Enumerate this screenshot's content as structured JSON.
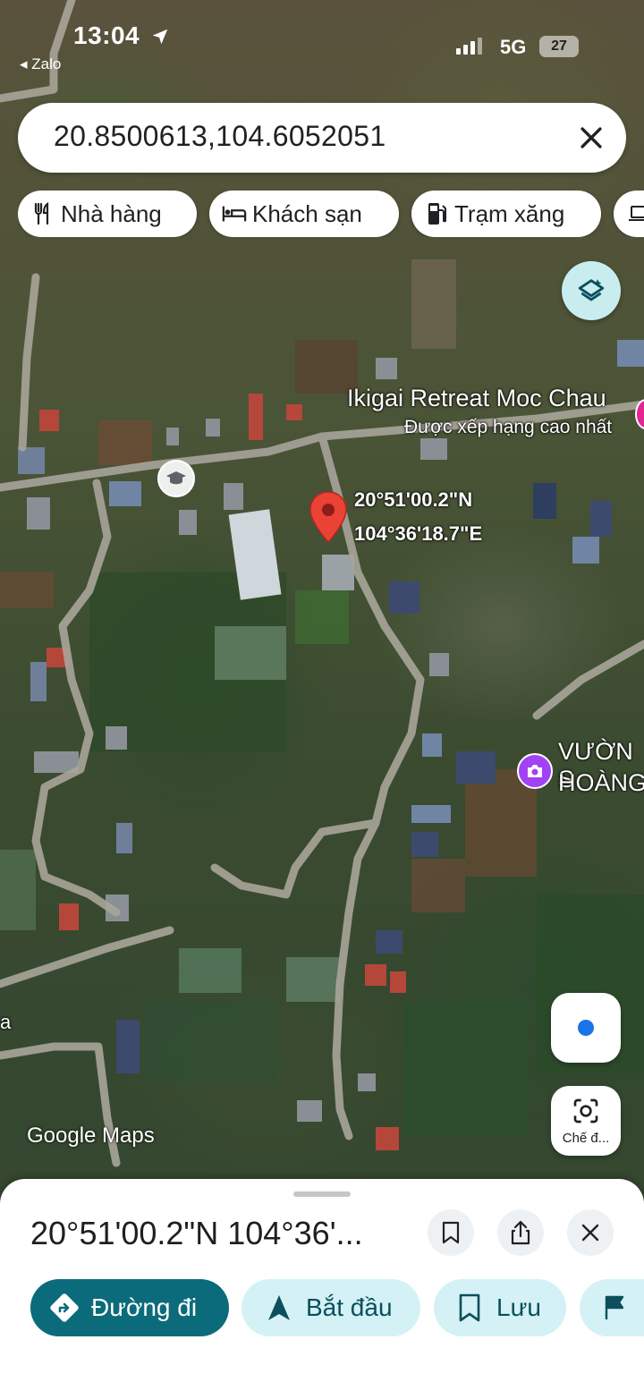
{
  "status_bar": {
    "time": "13:04",
    "back_app": "◂ Zalo",
    "network": "5G",
    "battery": "27"
  },
  "search": {
    "value": "20.8500613,104.6052051"
  },
  "chips": [
    {
      "label": "Nhà hàng",
      "icon": "fork-knife-icon"
    },
    {
      "label": "Khách sạn",
      "icon": "bed-icon"
    },
    {
      "label": "Trạm xăng",
      "icon": "gas-pump-icon"
    }
  ],
  "map": {
    "poi_title": "Ikigai Retreat Moc Chau",
    "poi_subtitle": "Được xếp hạng cao nhất",
    "pin_lat": "20°51'00.2\"N",
    "pin_lng": "104°36'18.7\"E",
    "garden_line1": "VƯỜN S",
    "garden_line2": "HOÀNG",
    "left_partial": "a",
    "watermark": "Google Maps",
    "lens_label": "Chế đ..."
  },
  "sheet": {
    "title": "20°51'00.2\"N 104°36'...",
    "actions": [
      {
        "label": "Đường đi",
        "icon": "directions-icon"
      },
      {
        "label": "Bắt đầu",
        "icon": "navigation-arrow-icon"
      },
      {
        "label": "Lưu",
        "icon": "bookmark-icon"
      }
    ]
  },
  "colors": {
    "primary": "#0b6b7a",
    "secondary": "#d4f1f5",
    "pin": "#ea4335",
    "location_dot": "#1a73e8"
  }
}
